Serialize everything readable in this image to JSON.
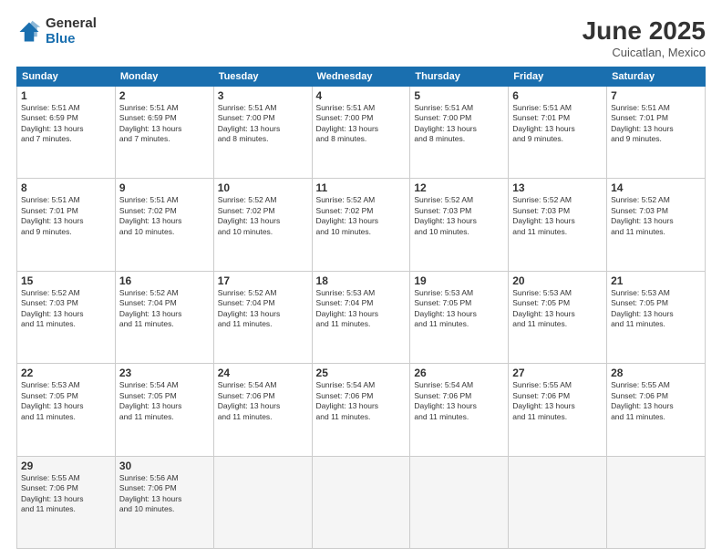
{
  "logo": {
    "general": "General",
    "blue": "Blue"
  },
  "title": "June 2025",
  "subtitle": "Cuicatlan, Mexico",
  "days_of_week": [
    "Sunday",
    "Monday",
    "Tuesday",
    "Wednesday",
    "Thursday",
    "Friday",
    "Saturday"
  ],
  "weeks": [
    [
      {
        "day": "1",
        "text": "Sunrise: 5:51 AM\nSunset: 6:59 PM\nDaylight: 13 hours\nand 7 minutes."
      },
      {
        "day": "2",
        "text": "Sunrise: 5:51 AM\nSunset: 6:59 PM\nDaylight: 13 hours\nand 7 minutes."
      },
      {
        "day": "3",
        "text": "Sunrise: 5:51 AM\nSunset: 7:00 PM\nDaylight: 13 hours\nand 8 minutes."
      },
      {
        "day": "4",
        "text": "Sunrise: 5:51 AM\nSunset: 7:00 PM\nDaylight: 13 hours\nand 8 minutes."
      },
      {
        "day": "5",
        "text": "Sunrise: 5:51 AM\nSunset: 7:00 PM\nDaylight: 13 hours\nand 8 minutes."
      },
      {
        "day": "6",
        "text": "Sunrise: 5:51 AM\nSunset: 7:01 PM\nDaylight: 13 hours\nand 9 minutes."
      },
      {
        "day": "7",
        "text": "Sunrise: 5:51 AM\nSunset: 7:01 PM\nDaylight: 13 hours\nand 9 minutes."
      }
    ],
    [
      {
        "day": "8",
        "text": "Sunrise: 5:51 AM\nSunset: 7:01 PM\nDaylight: 13 hours\nand 9 minutes."
      },
      {
        "day": "9",
        "text": "Sunrise: 5:51 AM\nSunset: 7:02 PM\nDaylight: 13 hours\nand 10 minutes."
      },
      {
        "day": "10",
        "text": "Sunrise: 5:52 AM\nSunset: 7:02 PM\nDaylight: 13 hours\nand 10 minutes."
      },
      {
        "day": "11",
        "text": "Sunrise: 5:52 AM\nSunset: 7:02 PM\nDaylight: 13 hours\nand 10 minutes."
      },
      {
        "day": "12",
        "text": "Sunrise: 5:52 AM\nSunset: 7:03 PM\nDaylight: 13 hours\nand 10 minutes."
      },
      {
        "day": "13",
        "text": "Sunrise: 5:52 AM\nSunset: 7:03 PM\nDaylight: 13 hours\nand 11 minutes."
      },
      {
        "day": "14",
        "text": "Sunrise: 5:52 AM\nSunset: 7:03 PM\nDaylight: 13 hours\nand 11 minutes."
      }
    ],
    [
      {
        "day": "15",
        "text": "Sunrise: 5:52 AM\nSunset: 7:03 PM\nDaylight: 13 hours\nand 11 minutes."
      },
      {
        "day": "16",
        "text": "Sunrise: 5:52 AM\nSunset: 7:04 PM\nDaylight: 13 hours\nand 11 minutes."
      },
      {
        "day": "17",
        "text": "Sunrise: 5:52 AM\nSunset: 7:04 PM\nDaylight: 13 hours\nand 11 minutes."
      },
      {
        "day": "18",
        "text": "Sunrise: 5:53 AM\nSunset: 7:04 PM\nDaylight: 13 hours\nand 11 minutes."
      },
      {
        "day": "19",
        "text": "Sunrise: 5:53 AM\nSunset: 7:05 PM\nDaylight: 13 hours\nand 11 minutes."
      },
      {
        "day": "20",
        "text": "Sunrise: 5:53 AM\nSunset: 7:05 PM\nDaylight: 13 hours\nand 11 minutes."
      },
      {
        "day": "21",
        "text": "Sunrise: 5:53 AM\nSunset: 7:05 PM\nDaylight: 13 hours\nand 11 minutes."
      }
    ],
    [
      {
        "day": "22",
        "text": "Sunrise: 5:53 AM\nSunset: 7:05 PM\nDaylight: 13 hours\nand 11 minutes."
      },
      {
        "day": "23",
        "text": "Sunrise: 5:54 AM\nSunset: 7:05 PM\nDaylight: 13 hours\nand 11 minutes."
      },
      {
        "day": "24",
        "text": "Sunrise: 5:54 AM\nSunset: 7:06 PM\nDaylight: 13 hours\nand 11 minutes."
      },
      {
        "day": "25",
        "text": "Sunrise: 5:54 AM\nSunset: 7:06 PM\nDaylight: 13 hours\nand 11 minutes."
      },
      {
        "day": "26",
        "text": "Sunrise: 5:54 AM\nSunset: 7:06 PM\nDaylight: 13 hours\nand 11 minutes."
      },
      {
        "day": "27",
        "text": "Sunrise: 5:55 AM\nSunset: 7:06 PM\nDaylight: 13 hours\nand 11 minutes."
      },
      {
        "day": "28",
        "text": "Sunrise: 5:55 AM\nSunset: 7:06 PM\nDaylight: 13 hours\nand 11 minutes."
      }
    ],
    [
      {
        "day": "29",
        "text": "Sunrise: 5:55 AM\nSunset: 7:06 PM\nDaylight: 13 hours\nand 11 minutes."
      },
      {
        "day": "30",
        "text": "Sunrise: 5:56 AM\nSunset: 7:06 PM\nDaylight: 13 hours\nand 10 minutes."
      },
      {
        "day": "",
        "text": ""
      },
      {
        "day": "",
        "text": ""
      },
      {
        "day": "",
        "text": ""
      },
      {
        "day": "",
        "text": ""
      },
      {
        "day": "",
        "text": ""
      }
    ]
  ]
}
